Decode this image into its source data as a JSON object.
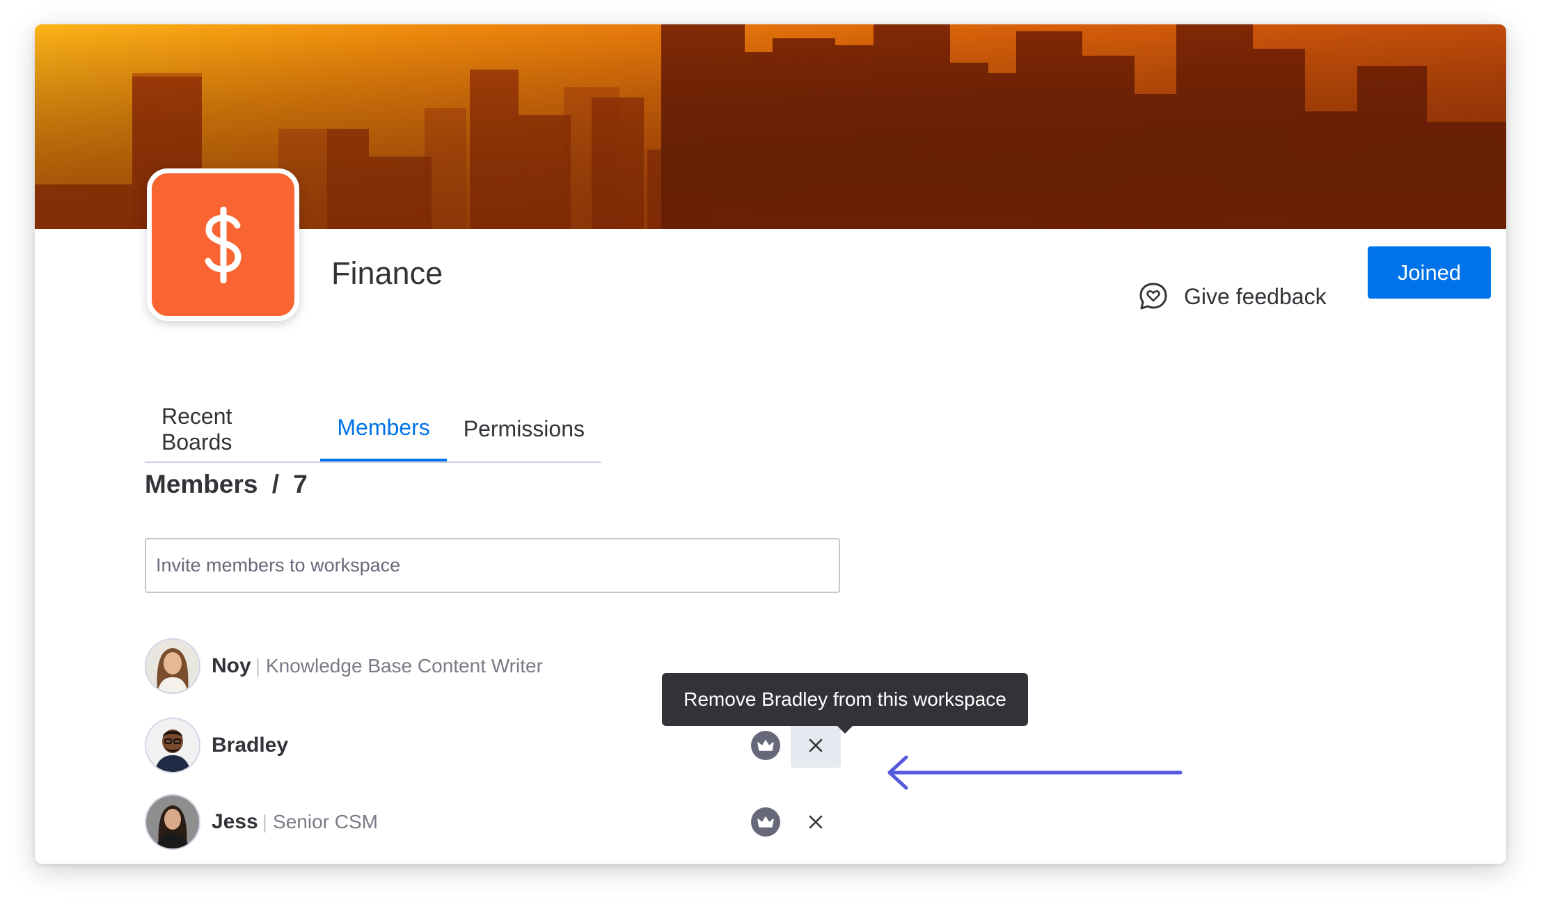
{
  "workspace": {
    "name": "Finance",
    "icon": "dollar-icon",
    "icon_color": "#f86532"
  },
  "header": {
    "feedback_label": "Give feedback",
    "feedback_icon": "chat-heart-icon",
    "joined_label": "Joined",
    "accent": "#0073ea"
  },
  "tabs": [
    {
      "label": "Recent Boards",
      "active": false
    },
    {
      "label": "Members",
      "active": true
    },
    {
      "label": "Permissions",
      "active": false
    }
  ],
  "members_section": {
    "title": "Members",
    "separator": "/",
    "count": "7",
    "invite_placeholder": "Invite members to workspace"
  },
  "members": [
    {
      "name": "Noy",
      "role": "Knowledge Base Content Writer",
      "sep": "|"
    },
    {
      "name": "Bradley",
      "role": "",
      "sep": ""
    },
    {
      "name": "Jess",
      "role": "Senior CSM",
      "sep": "|"
    }
  ],
  "tooltip": {
    "text": "Remove Bradley from this workspace"
  },
  "annotation": {
    "arrow_color": "#5559df"
  }
}
